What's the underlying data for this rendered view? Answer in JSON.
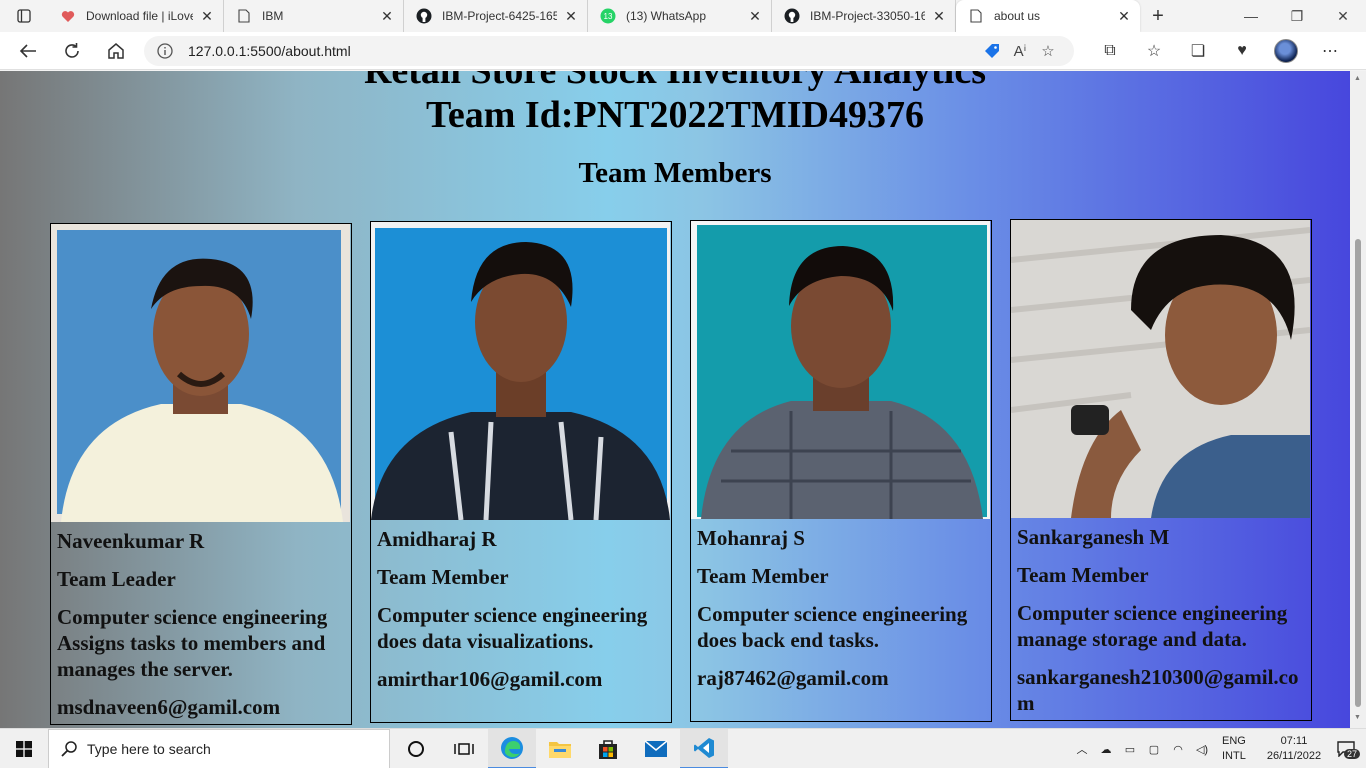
{
  "browser": {
    "tabs": [
      {
        "label": "Download file | iLoveP",
        "favicon": "heart-icon"
      },
      {
        "label": "IBM",
        "favicon": "page-icon"
      },
      {
        "label": "IBM-Project-6425-165",
        "favicon": "github-icon"
      },
      {
        "label": "(13) WhatsApp",
        "favicon": "whatsapp-icon"
      },
      {
        "label": "IBM-Project-33050-16",
        "favicon": "github-icon"
      },
      {
        "label": "about us",
        "favicon": "page-icon",
        "active": true
      }
    ],
    "url": "127.0.0.1:5500/about.html"
  },
  "page": {
    "title_line1": "Retail Store Stock Inventory Analytics",
    "title_line2": "Team Id:PNT2022TMID49376",
    "section_heading": "Team Members",
    "members": [
      {
        "name": "Naveenkumar R",
        "role": "Team Leader",
        "desc": "Computer science engineering Assigns tasks to members and manages the server.",
        "email": "msdnaveen6@gamil.com"
      },
      {
        "name": "Amidharaj R",
        "role": "Team Member",
        "desc": "Computer science engineering does data visualizations.",
        "email": "amirthar106@gamil.com"
      },
      {
        "name": "Mohanraj S",
        "role": "Team Member",
        "desc": "Computer science engineering does back end tasks.",
        "email": "raj87462@gamil.com"
      },
      {
        "name": "Sankarganesh M",
        "role": "Team Member",
        "desc": "Computer science engineering manage storage and data.",
        "email": "sankarganesh210300@gamil.com"
      }
    ]
  },
  "taskbar": {
    "search_placeholder": "Type here to search",
    "lang_line1": "ENG",
    "lang_line2": "INTL",
    "time": "07:11",
    "date": "26/11/2022",
    "notification_count": "27"
  }
}
